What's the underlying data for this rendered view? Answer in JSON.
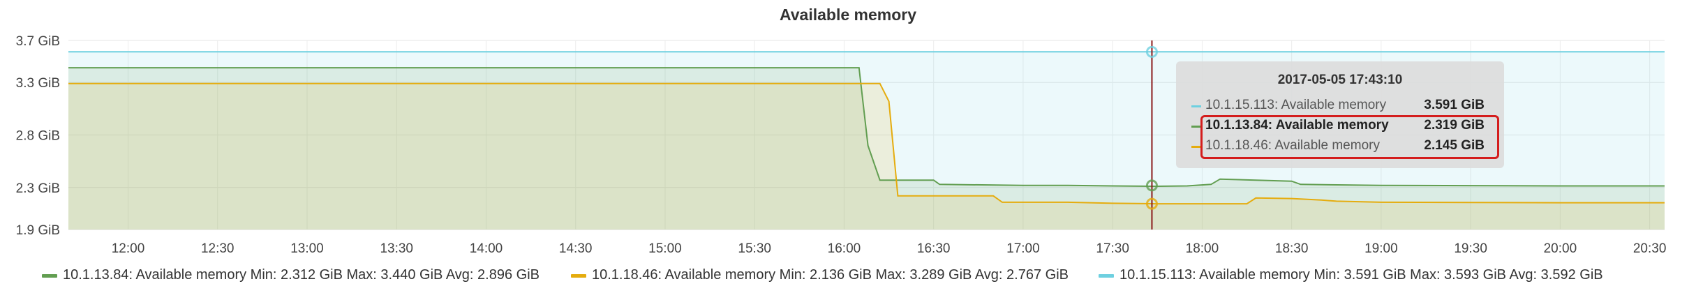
{
  "chart_data": {
    "type": "line",
    "title": "Available memory",
    "x_ticks": [
      "12:00",
      "12:30",
      "13:00",
      "13:30",
      "14:00",
      "14:30",
      "15:00",
      "15:30",
      "16:00",
      "16:30",
      "17:00",
      "17:30",
      "18:00",
      "18:30",
      "19:00",
      "19:30",
      "20:00",
      "20:30"
    ],
    "y_ticks": [
      "1.9 GiB",
      "2.3 GiB",
      "2.8 GiB",
      "3.3 GiB",
      "3.7 GiB"
    ],
    "x_range": [
      "11:40",
      "20:35"
    ],
    "ylim": [
      1.9,
      3.7
    ],
    "y_unit": "GiB",
    "grid": true,
    "legend_position": "bottom",
    "series": [
      {
        "name": "10.1.13.84: Available memory",
        "color": "#629e51",
        "fill": true,
        "x": [
          "11:40",
          "16:05",
          "16:08",
          "16:12",
          "16:30",
          "16:32",
          "17:00",
          "17:15",
          "17:30",
          "17:45",
          "17:55",
          "18:03",
          "18:06",
          "18:30",
          "18:33",
          "19:00",
          "19:30",
          "20:00",
          "20:35"
        ],
        "y": [
          3.44,
          3.44,
          2.7,
          2.37,
          2.37,
          2.33,
          2.32,
          2.32,
          2.315,
          2.312,
          2.315,
          2.33,
          2.38,
          2.36,
          2.33,
          2.32,
          2.318,
          2.315,
          2.315
        ],
        "stats": {
          "min": "2.312 GiB",
          "max": "3.440 GiB",
          "avg": "2.896 GiB"
        }
      },
      {
        "name": "10.1.18.46: Available memory",
        "color": "#e5ac0e",
        "fill": true,
        "x": [
          "11:40",
          "16:12",
          "16:15",
          "16:18",
          "16:30",
          "16:50",
          "16:53",
          "17:15",
          "17:30",
          "17:45",
          "18:15",
          "18:18",
          "18:30",
          "18:40",
          "18:45",
          "19:00",
          "19:30",
          "20:00",
          "20:35"
        ],
        "y": [
          3.29,
          3.29,
          3.12,
          2.22,
          2.22,
          2.22,
          2.16,
          2.16,
          2.15,
          2.145,
          2.145,
          2.2,
          2.195,
          2.18,
          2.17,
          2.16,
          2.158,
          2.155,
          2.155
        ],
        "stats": {
          "min": "2.136 GiB",
          "max": "3.289 GiB",
          "avg": "2.767 GiB"
        }
      },
      {
        "name": "10.1.15.113: Available memory",
        "color": "#6ed0e0",
        "fill": true,
        "x": [
          "11:40",
          "20:35"
        ],
        "y": [
          3.592,
          3.592
        ],
        "stats": {
          "min": "3.591 GiB",
          "max": "3.593 GiB",
          "avg": "3.592 GiB"
        }
      }
    ],
    "crosshair": {
      "x": "17:43:10"
    },
    "tooltip": {
      "time": "2017-05-05 17:43:10",
      "rows": [
        {
          "series": "10.1.15.113: Available memory",
          "value": "3.591 GiB",
          "color": "#6ed0e0",
          "highlight": false
        },
        {
          "series": "10.1.13.84: Available memory",
          "value": "2.319 GiB",
          "color": "#629e51",
          "highlight": true
        },
        {
          "series": "10.1.18.46: Available memory",
          "value": "2.145 GiB",
          "color": "#e5ac0e",
          "highlight": false
        }
      ]
    },
    "legend": [
      {
        "name": "10.1.13.84: Available memory",
        "color": "#629e51",
        "text": "10.1.13.84: Available memory  Min: 2.312 GiB  Max: 3.440 GiB  Avg: 2.896 GiB"
      },
      {
        "name": "10.1.18.46: Available memory",
        "color": "#e5ac0e",
        "text": "10.1.18.46: Available memory  Min: 2.136 GiB  Max: 3.289 GiB  Avg: 2.767 GiB"
      },
      {
        "name": "10.1.15.113: Available memory",
        "color": "#6ed0e0",
        "text": "10.1.15.113: Available memory  Min: 3.591 GiB  Max: 3.593 GiB  Avg: 3.592 GiB"
      }
    ]
  }
}
